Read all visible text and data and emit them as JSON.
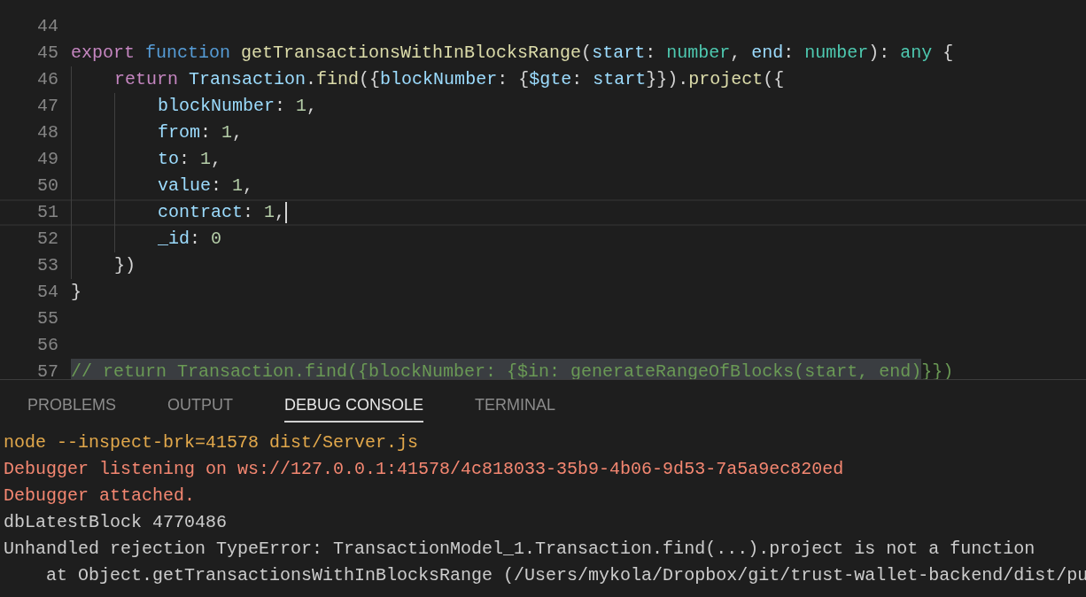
{
  "editor": {
    "lines": [
      {
        "number": "44",
        "current": false
      },
      {
        "number": "45",
        "current": false,
        "tokens": [
          {
            "kind": "keyword",
            "text": "export "
          },
          {
            "kind": "storage",
            "text": "function "
          },
          {
            "kind": "func",
            "text": "getTransactionsWithInBlocksRange"
          },
          {
            "kind": "punct",
            "text": "("
          },
          {
            "kind": "var",
            "text": "start"
          },
          {
            "kind": "punct",
            "text": ": "
          },
          {
            "kind": "type",
            "text": "number"
          },
          {
            "kind": "punct",
            "text": ", "
          },
          {
            "kind": "var",
            "text": "end"
          },
          {
            "kind": "punct",
            "text": ": "
          },
          {
            "kind": "type",
            "text": "number"
          },
          {
            "kind": "punct",
            "text": "): "
          },
          {
            "kind": "type",
            "text": "any"
          },
          {
            "kind": "punct",
            "text": " {"
          }
        ]
      },
      {
        "number": "46",
        "current": false,
        "tokens": [
          {
            "kind": "keyword",
            "text": "    return "
          },
          {
            "kind": "var",
            "text": "Transaction"
          },
          {
            "kind": "punct",
            "text": "."
          },
          {
            "kind": "func",
            "text": "find"
          },
          {
            "kind": "punct",
            "text": "({"
          },
          {
            "kind": "var",
            "text": "blockNumber"
          },
          {
            "kind": "punct",
            "text": ": {"
          },
          {
            "kind": "var",
            "text": "$gte"
          },
          {
            "kind": "punct",
            "text": ": "
          },
          {
            "kind": "var",
            "text": "start"
          },
          {
            "kind": "punct",
            "text": "}})."
          },
          {
            "kind": "func",
            "text": "project"
          },
          {
            "kind": "punct",
            "text": "({"
          }
        ]
      },
      {
        "number": "47",
        "current": false,
        "tokens": [
          {
            "kind": "var",
            "text": "        blockNumber"
          },
          {
            "kind": "punct",
            "text": ": "
          },
          {
            "kind": "num",
            "text": "1"
          },
          {
            "kind": "punct",
            "text": ","
          }
        ]
      },
      {
        "number": "48",
        "current": false,
        "tokens": [
          {
            "kind": "var",
            "text": "        from"
          },
          {
            "kind": "punct",
            "text": ": "
          },
          {
            "kind": "num",
            "text": "1"
          },
          {
            "kind": "punct",
            "text": ","
          }
        ]
      },
      {
        "number": "49",
        "current": false,
        "tokens": [
          {
            "kind": "var",
            "text": "        to"
          },
          {
            "kind": "punct",
            "text": ": "
          },
          {
            "kind": "num",
            "text": "1"
          },
          {
            "kind": "punct",
            "text": ","
          }
        ]
      },
      {
        "number": "50",
        "current": false,
        "tokens": [
          {
            "kind": "var",
            "text": "        value"
          },
          {
            "kind": "punct",
            "text": ": "
          },
          {
            "kind": "num",
            "text": "1"
          },
          {
            "kind": "punct",
            "text": ","
          }
        ]
      },
      {
        "number": "51",
        "current": true,
        "tokens": [
          {
            "kind": "var",
            "text": "        contract"
          },
          {
            "kind": "punct",
            "text": ": "
          },
          {
            "kind": "num",
            "text": "1"
          },
          {
            "kind": "punct",
            "text": ","
          }
        ]
      },
      {
        "number": "52",
        "current": false,
        "tokens": [
          {
            "kind": "var",
            "text": "        _id"
          },
          {
            "kind": "punct",
            "text": ": "
          },
          {
            "kind": "num",
            "text": "0"
          }
        ]
      },
      {
        "number": "53",
        "current": false,
        "tokens": [
          {
            "kind": "punct",
            "text": "    })"
          }
        ]
      },
      {
        "number": "54",
        "current": false,
        "tokens": [
          {
            "kind": "punct",
            "text": "}"
          }
        ]
      },
      {
        "number": "55",
        "current": false
      },
      {
        "number": "56",
        "current": false
      },
      {
        "number": "57",
        "current": false,
        "tokens": [
          {
            "kind": "selection",
            "text": "// return Transaction.find({blockNumber: {$in: generateRangeOfBlocks(start, end)"
          },
          {
            "kind": "comment",
            "text": "}})"
          }
        ]
      }
    ]
  },
  "panel": {
    "tabs": [
      {
        "label": "PROBLEMS",
        "selected": false
      },
      {
        "label": "OUTPUT",
        "selected": false
      },
      {
        "label": "DEBUG CONSOLE",
        "selected": true
      },
      {
        "label": "TERMINAL",
        "selected": false
      }
    ],
    "console": [
      {
        "kind": "command",
        "text": "node --inspect-brk=41578 dist/Server.js"
      },
      {
        "kind": "error",
        "text": "Debugger listening on ws://127.0.0.1:41578/4c818033-35b9-4b06-9d53-7a5a9ec820ed"
      },
      {
        "kind": "error",
        "text": "Debugger attached."
      },
      {
        "kind": "log",
        "text": "dbLatestBlock 4770486"
      },
      {
        "kind": "log",
        "text": "Unhandled rejection TypeError: TransactionModel_1.Transaction.find(...).project is not a function"
      },
      {
        "kind": "log",
        "text": "    at Object.getTransactionsWithInBlocksRange (/Users/mykola/Dropbox/git/trust-wallet-backend/dist/pu"
      }
    ]
  }
}
